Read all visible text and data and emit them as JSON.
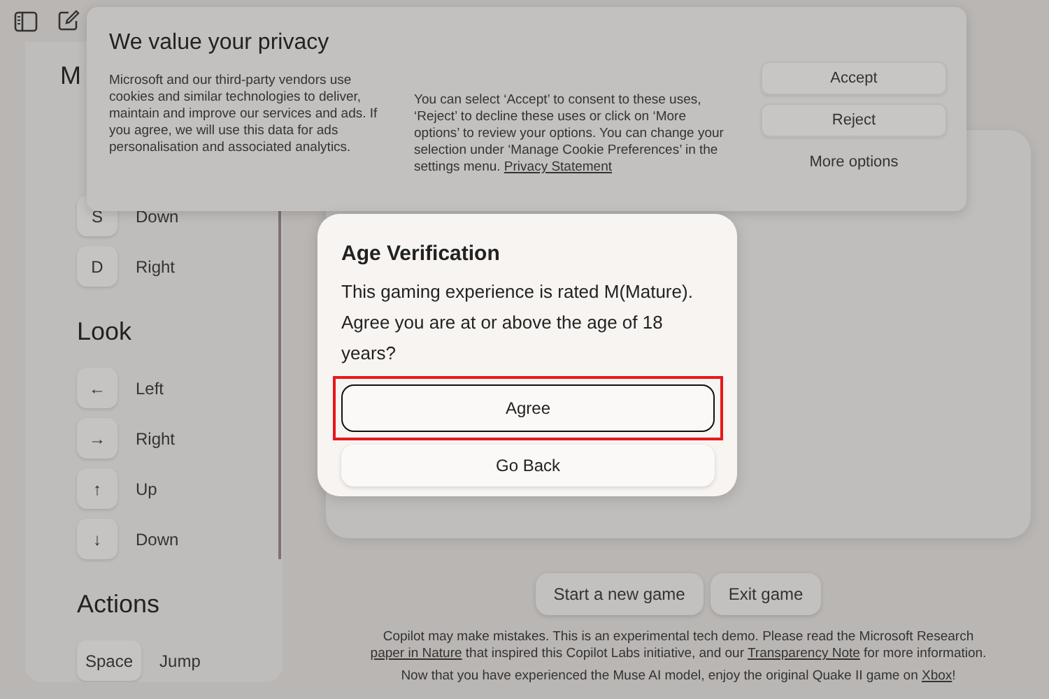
{
  "controls_panel": {
    "sections": [
      {
        "heading": "M",
        "rows": [
          {
            "key": "S",
            "action": "Down"
          },
          {
            "key": "D",
            "action": "Right"
          }
        ]
      },
      {
        "heading": "Look",
        "rows": [
          {
            "key": "←",
            "action": "Left"
          },
          {
            "key": "→",
            "action": "Right"
          },
          {
            "key": "↑",
            "action": "Up"
          },
          {
            "key": "↓",
            "action": "Down"
          }
        ]
      },
      {
        "heading": "Actions",
        "rows": [
          {
            "key": "Space",
            "action": "Jump"
          }
        ]
      }
    ]
  },
  "game_buttons": [
    "Start a new game",
    "Exit game"
  ],
  "footer": [
    [
      {
        "text": "Copilot may make mistakes. This is an experimental tech demo. Please read the Microsoft Research ",
        "link": false
      },
      {
        "text": "paper in Nature",
        "link": true
      },
      {
        "text": " that inspired this Copilot Labs initiative, and our ",
        "link": false
      },
      {
        "text": "Transparency Note",
        "link": true
      },
      {
        "text": " for more information.",
        "link": false
      }
    ],
    [
      {
        "text": "Now that you have experienced the Muse AI model, enjoy the original Quake II game on ",
        "link": false
      },
      {
        "text": "Xbox",
        "link": true
      },
      {
        "text": "!",
        "link": false
      }
    ]
  ],
  "privacy_banner": {
    "title": "We value your privacy",
    "text_left": "Microsoft and our third-party vendors use cookies and similar technologies to deliver, maintain and improve our services and ads. If you agree, we will use this data for ads personalisation and associated analytics.",
    "text_right": "You can select ‘Accept’ to consent to these uses, ‘Reject’ to decline these uses or click on ‘More options’ to review your options. You can change your selection under ‘Manage Cookie Preferences’ in the settings menu.",
    "link": "Privacy Statement",
    "buttons": [
      {
        "label": "Accept",
        "kind": "filled"
      },
      {
        "label": "Reject",
        "kind": "filled"
      },
      {
        "label": "More options",
        "kind": "plain"
      }
    ]
  },
  "age_dialog": {
    "title": "Age Verification",
    "message": "This gaming experience is rated M(Mature). Agree you are at or above the age of 18 years?",
    "buttons": [
      {
        "label": "Agree",
        "highlighted": true
      },
      {
        "label": "Go Back",
        "highlighted": false
      }
    ]
  }
}
